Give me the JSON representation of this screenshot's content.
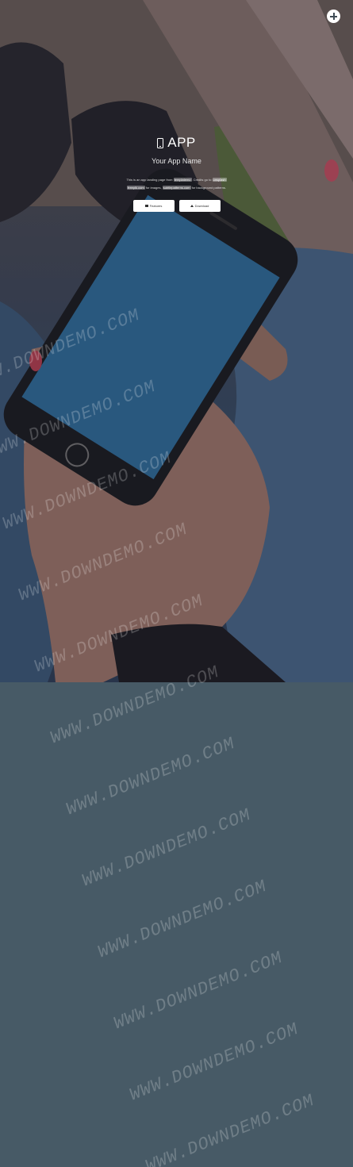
{
  "header": {
    "menu_icon": "plus-circle-icon"
  },
  "hero": {
    "brand_icon": "mobile-phone-icon",
    "title": "APP",
    "subtitle": "Your App Name",
    "description": {
      "p1": "This is an app landing page from ",
      "h1": "templatemo",
      "p2": ". Credits go to ",
      "h2": "unsplash",
      "p3": " ",
      "h3": "freepik.com",
      "p4": " for images, ",
      "h4": "subtlepatterns.com",
      "p5": " for background patterns."
    },
    "buttons": {
      "features_label": "Features",
      "download_label": "Download"
    }
  },
  "watermark": {
    "text": "WWW.DOWNDEMO.COM"
  },
  "colors": {
    "page_background": "#475a66",
    "button_background": "#ffffff"
  }
}
